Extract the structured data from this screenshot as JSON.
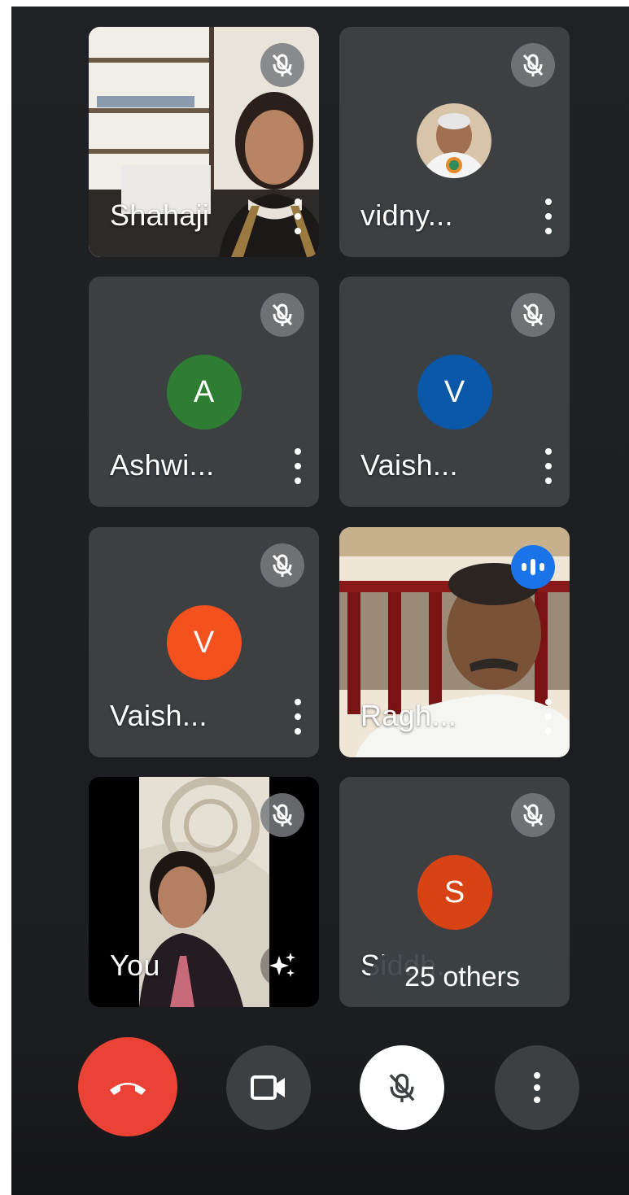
{
  "participants": [
    {
      "name": "Shahaji",
      "type": "video",
      "muted": true
    },
    {
      "name": "vidny...",
      "type": "photo",
      "muted": true
    },
    {
      "name": "Ashwi...",
      "type": "avatar",
      "initial": "A",
      "color": "#2e7d32",
      "muted": true
    },
    {
      "name": "Vaish...",
      "type": "avatar",
      "initial": "V",
      "color": "#0b57a8",
      "muted": true
    },
    {
      "name": "Vaish...",
      "type": "avatar",
      "initial": "V",
      "color": "#f4511e",
      "muted": true
    },
    {
      "name": "Ragh...",
      "type": "video",
      "muted": false,
      "speaking": true
    },
    {
      "name": "You",
      "type": "video",
      "muted": true
    },
    {
      "name": "Siddh...",
      "type": "avatar",
      "initial": "S",
      "color": "#d84315",
      "muted": true
    }
  ],
  "others_label": "25 others",
  "controls": {
    "end_call": {
      "icon": "phone-hangup-icon",
      "color": "#ea4335"
    },
    "camera": {
      "icon": "video-camera-icon",
      "color": "#3c4043"
    },
    "mic": {
      "icon": "mic-off-icon",
      "color": "#ffffff"
    },
    "more": {
      "icon": "more-vertical-icon",
      "color": "#3c4043"
    }
  }
}
